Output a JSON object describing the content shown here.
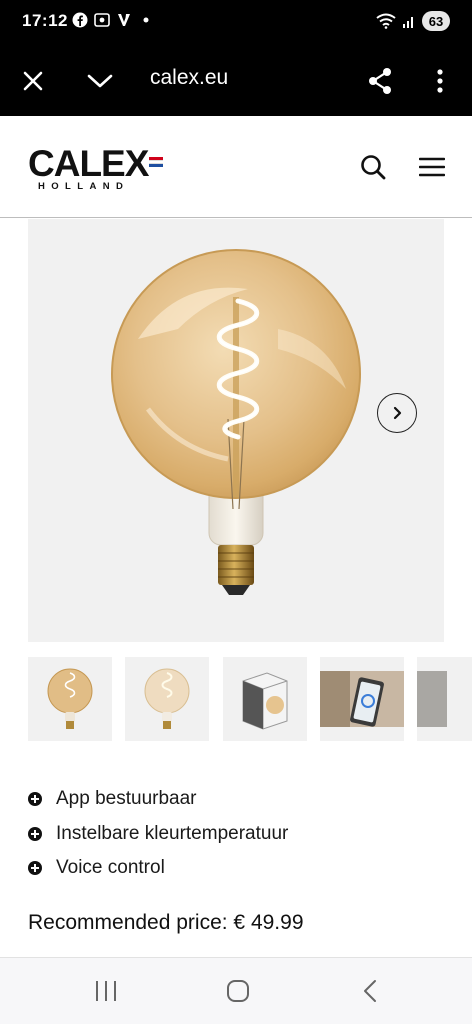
{
  "status_bar": {
    "time": "17:12",
    "left_icons": [
      "facebook-icon",
      "screen-record-icon",
      "v-app-icon",
      "dot-icon"
    ],
    "right_icons": [
      "wifi-icon",
      "signal-icon"
    ],
    "battery": "63"
  },
  "browser": {
    "url": "calex.eu",
    "buttons": [
      "close-icon",
      "chevron-down-icon",
      "share-icon",
      "more-vert-icon"
    ]
  },
  "header": {
    "logo_word": "CALEX",
    "logo_sub": "HOLLAND",
    "flag_colors": [
      "#d0021b",
      "#ffffff",
      "#1e4fa1"
    ],
    "icons": [
      "search-icon",
      "menu-icon"
    ]
  },
  "product": {
    "image": "large globe filament bulb (gold)",
    "next_icon": "chevron-right-icon"
  },
  "thumbnails": [
    {
      "name": "thumb-bulb-gold"
    },
    {
      "name": "thumb-bulb-lit"
    },
    {
      "name": "thumb-box"
    },
    {
      "name": "thumb-app"
    },
    {
      "name": "thumb-partial"
    }
  ],
  "features": [
    {
      "label": "App bestuurbaar"
    },
    {
      "label": "Instelbare kleurtemperatuur"
    },
    {
      "label": "Voice control"
    }
  ],
  "price": {
    "label": "Recommended price: € 49.99"
  },
  "nav": {
    "buttons": [
      "recents-icon",
      "home-icon",
      "back-icon"
    ]
  }
}
